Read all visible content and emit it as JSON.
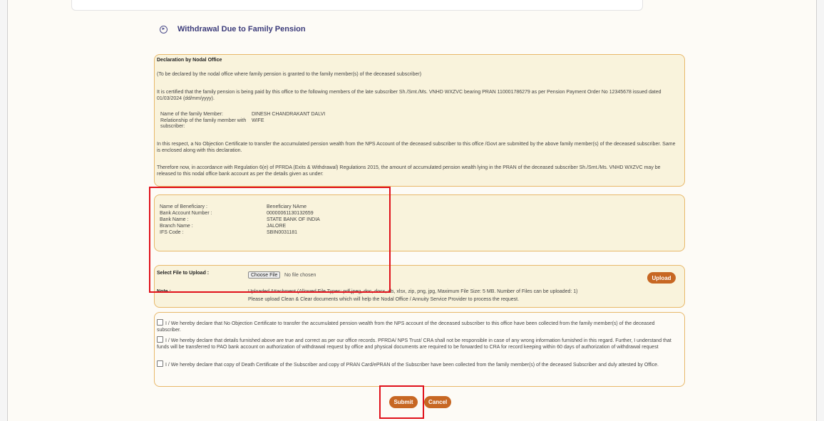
{
  "page": {
    "title": "Withdrawal Due to Family Pension"
  },
  "declaration": {
    "heading": "Declaration by Nodal Office",
    "intro": "(To be declared by the nodal office where family pension is granted to the family member(s) of the deceased subscriber)",
    "certified": "It is certified that the family pension is being paid by this office to the following members of the late subscriber Sh./Smt./Ms. VNHD WXZVC bearing PRAN 110001786279 as per Pension Payment Order No 12345678 issued dated 01/03/2024 (dd/mm/yyyy).",
    "member_label": "Name of the family Member:",
    "member_value": "DINESH CHANDRAKANT DALVI",
    "relationship_label": "Relationship of the family member with subscriber:",
    "relationship_value": "WIFE",
    "noc_text": "In this respect, a No Objection Certificate to transfer the accumulated pension wealth from the NPS Account of the deceased subscriber to this office /Govt are submitted by the above family member(s) of the deceased subscriber. Same is enclosed along with this declaration.",
    "therefore_text": "Therefore now, in accordance with Regulation 6(e) of PFRDA (Exits & Withdrawal) Regulations 2015, the amount of accumulated pension wealth lying in the PRAN of the deceased subscriber Sh./Smt./Ms. VNHD WXZVC may be released to this nodal office bank account as per the details given as under:"
  },
  "beneficiary": {
    "rows": [
      {
        "label": "Name of Beneficiary :",
        "value": "Beneficiary NAme"
      },
      {
        "label": "Bank Account Number :",
        "value": "00000061130132659"
      },
      {
        "label": "Bank Name :",
        "value": "STATE BANK OF INDIA"
      },
      {
        "label": "Branch Name :",
        "value": "JALORE"
      },
      {
        "label": "IFS Code :",
        "value": "SBIN0031181"
      }
    ]
  },
  "upload": {
    "label": "Select File to Upload :",
    "choose_button": "Choose File",
    "no_file_text": "No file chosen",
    "upload_button": "Upload",
    "note_label": "Note :",
    "note_line1": "Uploaded Attachment (Allowed File Types: pdf,jpeg, doc, docx, xls, xlsx, zip, png, jpg, Maximum File Size: 5 MB. Number of Files can be uploaded: 1)",
    "note_line2": "Please upload Clean & Clear documents which will help the Nodal Office / Annuity Service Provider to process the request."
  },
  "declarations": [
    "I / We hereby declare that No Objection Certificate to transfer the accumulated pension wealth from the NPS account of the deceased subscriber to this office have been collected from the family member(s) of the deceased subscriber.",
    "I / We hereby declare that details furnished above are true and correct as per our office records. PFRDA/ NPS Trust/ CRA shall not be responsible in case of any wrong information furnished in this regard. Further, I understand that funds will be transferred to PAO bank account on authorization of withdrawal request by office and physical documents are required to be forwarded to CRA for record keeping within 60 days of authorization of withdrawal request",
    "I / We hereby declare that copy of Death Certificate of the Subscriber and copy of PRAN Card/ePRAN of the Subscriber have been collected from the family member(s) of the deceased Subscriber and duly attested by Office."
  ],
  "actions": {
    "submit": "Submit",
    "cancel": "Cancel"
  },
  "colors": {
    "accent": "#c76723",
    "panel_bg": "#f9f3dc",
    "panel_border": "#e8b86a",
    "highlight": "#e0101a",
    "title": "#3b3b7a"
  }
}
